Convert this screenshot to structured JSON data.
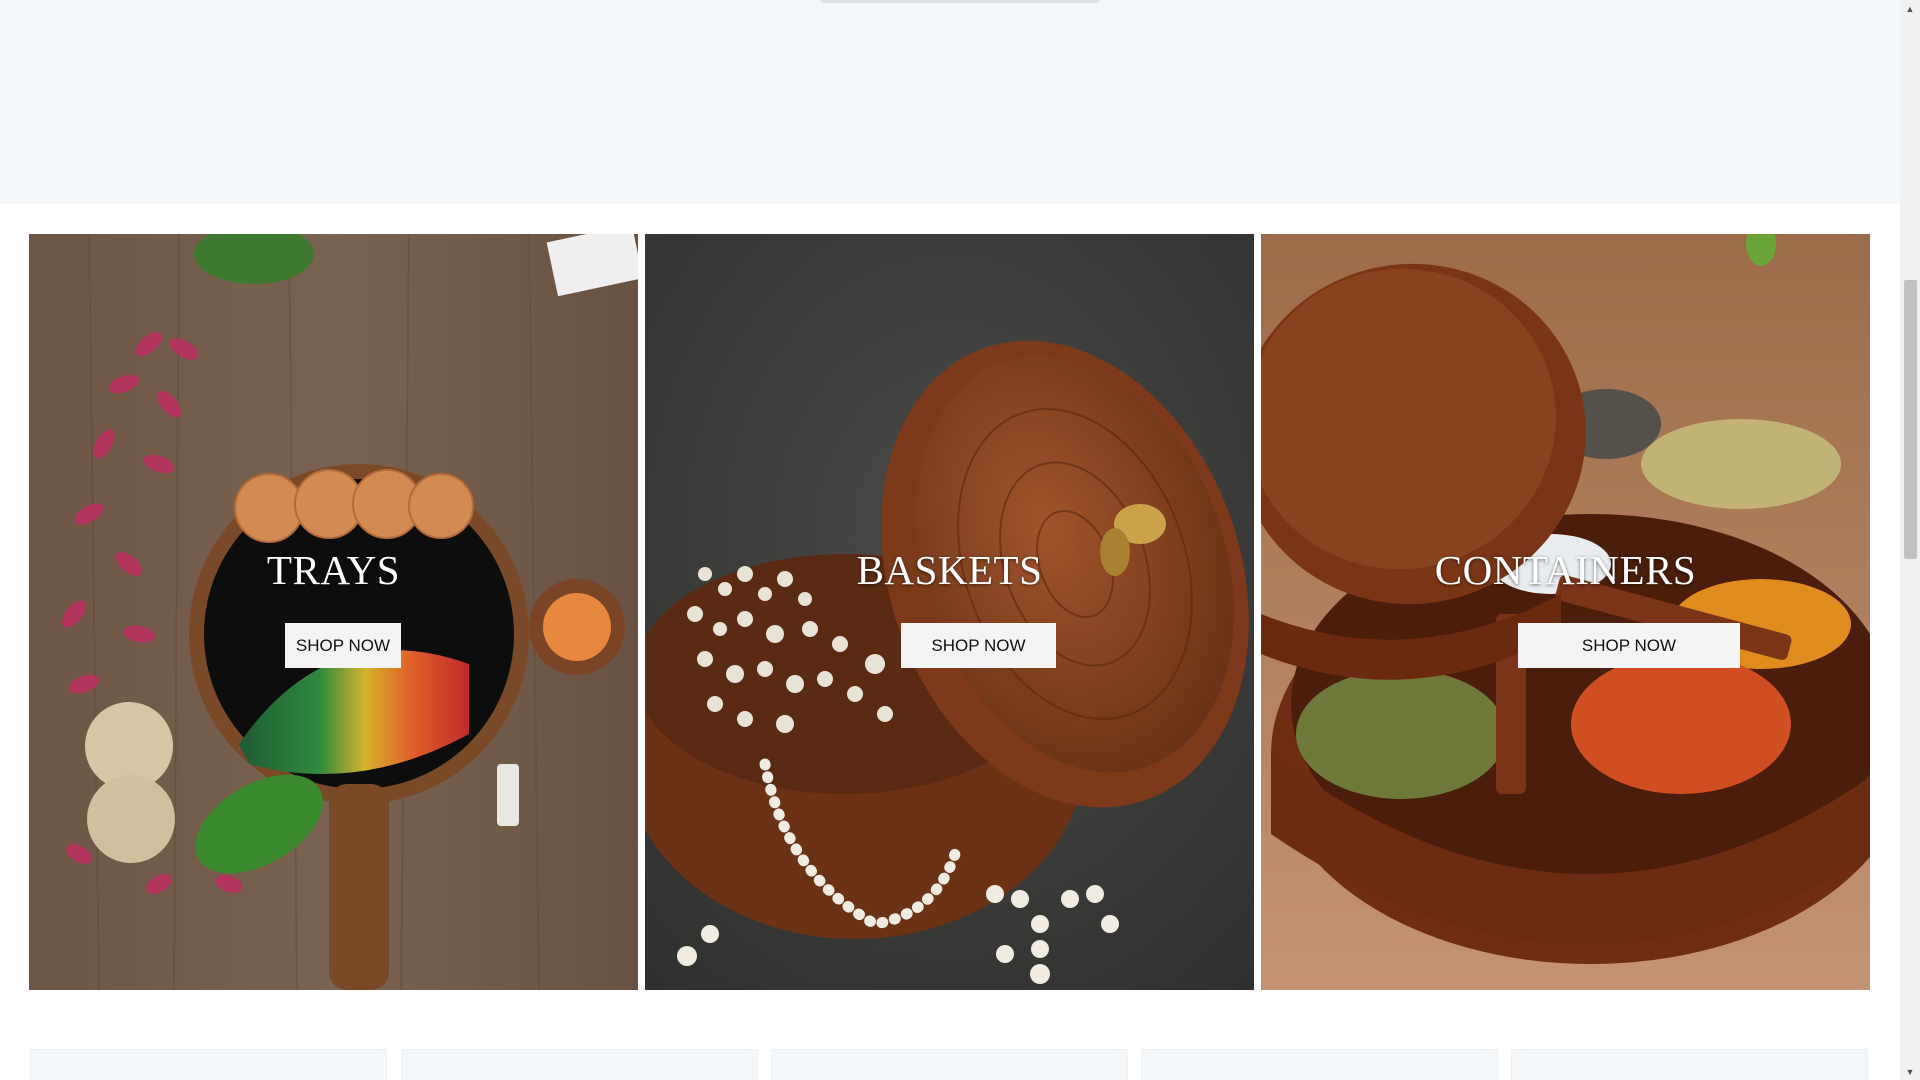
{
  "categories": [
    {
      "title": "TRAYS",
      "button_label": "SHOP NOW"
    },
    {
      "title": "BASKETS",
      "button_label": "SHOP NOW"
    },
    {
      "title": "CONTAINERS",
      "button_label": "SHOP NOW"
    }
  ],
  "scrollbar": {
    "up_icon": "▲",
    "down_icon": "▼"
  }
}
